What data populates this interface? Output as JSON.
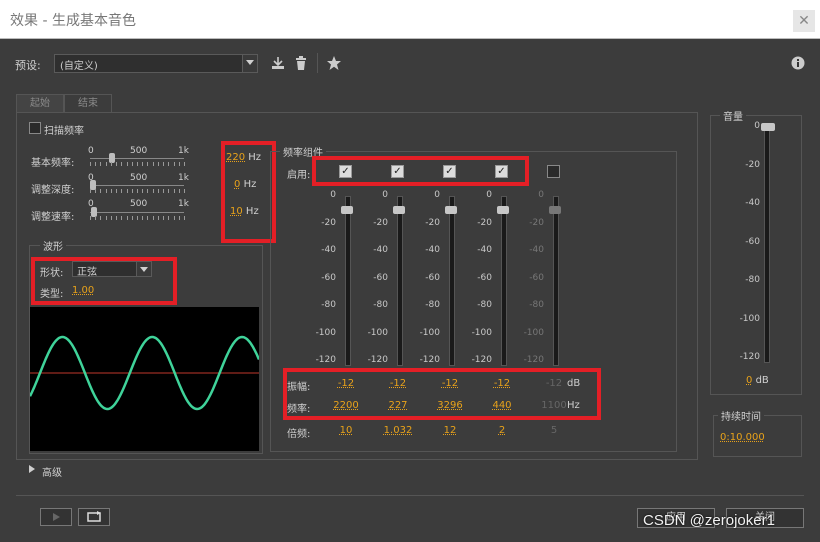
{
  "window": {
    "title": "效果 - 生成基本音色",
    "close_glyph": "✕"
  },
  "preset": {
    "label": "预设:",
    "value": "(自定义)"
  },
  "toolbar_icons": [
    "save-preset-icon",
    "delete-icon",
    "favorite-star-icon",
    "info-icon"
  ],
  "tabs": [
    {
      "label": "起始"
    },
    {
      "label": "结束"
    }
  ],
  "sweep": {
    "label": "扫描频率"
  },
  "sliders_scale": {
    "min": "0",
    "mid": "500",
    "max": "1k"
  },
  "params": [
    {
      "label": "基本频率:",
      "value": "220",
      "unit": "Hz",
      "level": 0.22
    },
    {
      "label": "调整深度:",
      "value": "0",
      "unit": "Hz",
      "level": 0
    },
    {
      "label": "调整速率:",
      "value": "10",
      "unit": "Hz",
      "level": 0.01
    }
  ],
  "waveform": {
    "legend": "波形",
    "shape_label": "形状:",
    "shape_value": "正弦",
    "type_label": "类型:",
    "type_value": "1.00"
  },
  "components": {
    "legend": "频率组件",
    "enable_label": "启用:",
    "db_scale": [
      "0",
      "-20",
      "-40",
      "-60",
      "-80",
      "-100",
      "-120"
    ],
    "amp_label": "振幅:",
    "freq_label": "频率:",
    "mult_label": "倍频:",
    "db_unit": "dB",
    "hz_unit": "Hz",
    "channels": [
      {
        "enabled": true,
        "amp": "-12",
        "freq": "2200",
        "mult": "10"
      },
      {
        "enabled": true,
        "amp": "-12",
        "freq": "227",
        "mult": "1.032"
      },
      {
        "enabled": true,
        "amp": "-12",
        "freq": "3296",
        "mult": "12"
      },
      {
        "enabled": true,
        "amp": "-12",
        "freq": "440",
        "mult": "2"
      },
      {
        "enabled": false,
        "amp": "-12",
        "freq": "1100",
        "mult": "5"
      }
    ]
  },
  "volume": {
    "label": "音量",
    "scale": [
      "0",
      "-20",
      "-40",
      "-60",
      "-80",
      "-100",
      "-120"
    ],
    "value": "0",
    "unit": "dB"
  },
  "duration": {
    "label": "持续时间",
    "value": "0:10.000"
  },
  "advanced": {
    "label": "高级"
  },
  "buttons": {
    "apply": "应用",
    "close": "关闭"
  },
  "watermark": "CSDN @zerojoker1",
  "colors": {
    "accent": "#e8a21a",
    "highlight_box": "#e41f26",
    "wave": "#3fd39a",
    "midline": "#c0392b"
  }
}
